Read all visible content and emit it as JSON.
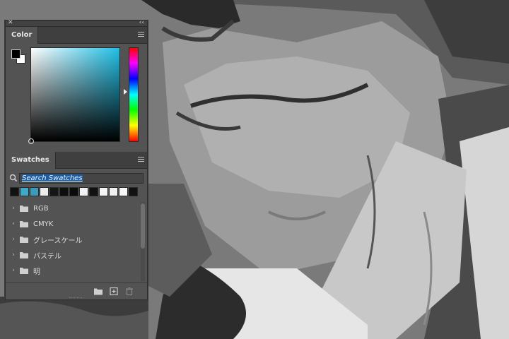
{
  "colors": {
    "panel_bg": "#535353",
    "accent": "#1a5ea8",
    "foreground_color": "#000000",
    "background_color": "#ffffff",
    "field_hue": "#20bfe6"
  },
  "color_panel": {
    "tab_label": "Color",
    "menu_icon": "hamburger-menu-icon"
  },
  "swatches_panel": {
    "tab_label": "Swatches",
    "menu_icon": "hamburger-menu-icon",
    "search": {
      "value": "Search Swatches",
      "icon": "search-icon"
    },
    "recent_swatches": [
      "#111111",
      "#3fa9c9",
      "#3b9bb8",
      "#ececec",
      "#151515",
      "#0d0d0d",
      "#0a0a0a",
      "#f2f2f2",
      "#111111",
      "#f5f5f5",
      "#f0f0f0",
      "#f7f7f7",
      "#111111"
    ],
    "folders": [
      {
        "label": "RGB"
      },
      {
        "label": "CMYK"
      },
      {
        "label": "グレースケール"
      },
      {
        "label": "パステル"
      },
      {
        "label": "明"
      }
    ],
    "bottom_icons": [
      "new-group-folder-icon",
      "new-swatch-icon",
      "trash-icon"
    ]
  }
}
